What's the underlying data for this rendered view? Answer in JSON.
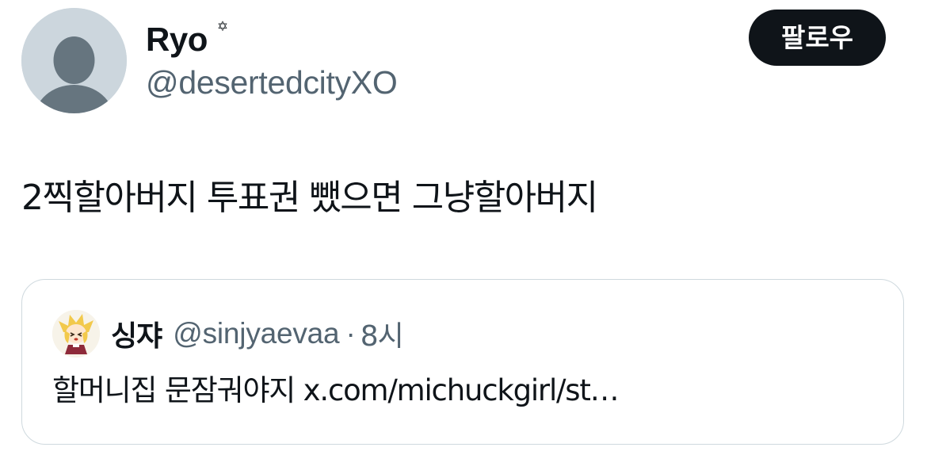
{
  "author": {
    "display_name": "Ryo",
    "name_emoji": "✡",
    "handle": "@desertedcityXO",
    "avatar_icon": "default-profile-silhouette"
  },
  "follow_button": {
    "label": "팔로우"
  },
  "tweet": {
    "text": "2찍할아버지 투표권 뺐으면 그냥할아버지"
  },
  "quoted_tweet": {
    "display_name": "싱쟈",
    "handle": "@sinjyaevaa",
    "separator": "·",
    "time": "8시",
    "text": "할머니집 문잠궈야지 x.com/michuckgirl/st…",
    "avatar_icon": "anime-character-avatar"
  },
  "colors": {
    "text_primary": "#0f1419",
    "text_secondary": "#536471",
    "border": "#cfd9de",
    "button_bg": "#0f1419",
    "button_text": "#ffffff"
  }
}
